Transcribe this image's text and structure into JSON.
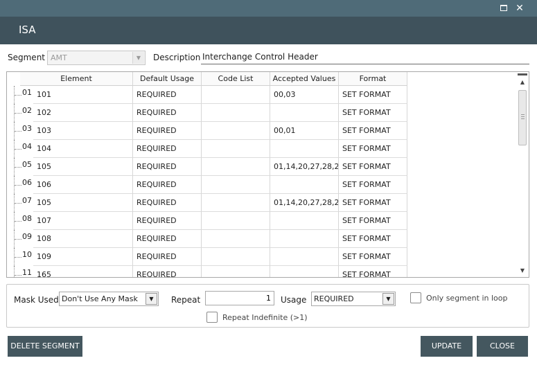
{
  "window": {
    "title": "ISA",
    "max_icon": "maximize-icon",
    "close_icon": "close-icon",
    "close_glyph": "✕"
  },
  "segment": {
    "label": "Segment",
    "value": "AMT"
  },
  "description": {
    "label": "Description",
    "value": "Interchange Control Header"
  },
  "grid": {
    "columns": [
      "Element",
      "Default Usage",
      "Code List",
      "Accepted Values",
      "Format"
    ],
    "rows": [
      {
        "num": "01",
        "element": "101",
        "usage": "REQUIRED",
        "code_list": "",
        "accepted": "00,03",
        "format": "SET FORMAT"
      },
      {
        "num": "02",
        "element": "102",
        "usage": "REQUIRED",
        "code_list": "",
        "accepted": "",
        "format": "SET FORMAT"
      },
      {
        "num": "03",
        "element": "103",
        "usage": "REQUIRED",
        "code_list": "",
        "accepted": "00,01",
        "format": "SET FORMAT"
      },
      {
        "num": "04",
        "element": "104",
        "usage": "REQUIRED",
        "code_list": "",
        "accepted": "",
        "format": "SET FORMAT"
      },
      {
        "num": "05",
        "element": "105",
        "usage": "REQUIRED",
        "code_list": "",
        "accepted": "01,14,20,27,28,2",
        "format": "SET FORMAT"
      },
      {
        "num": "06",
        "element": "106",
        "usage": "REQUIRED",
        "code_list": "",
        "accepted": "",
        "format": "SET FORMAT"
      },
      {
        "num": "07",
        "element": "105",
        "usage": "REQUIRED",
        "code_list": "",
        "accepted": "01,14,20,27,28,2",
        "format": "SET FORMAT"
      },
      {
        "num": "08",
        "element": "107",
        "usage": "REQUIRED",
        "code_list": "",
        "accepted": "",
        "format": "SET FORMAT"
      },
      {
        "num": "09",
        "element": "108",
        "usage": "REQUIRED",
        "code_list": "",
        "accepted": "",
        "format": "SET FORMAT"
      },
      {
        "num": "10",
        "element": "109",
        "usage": "REQUIRED",
        "code_list": "",
        "accepted": "",
        "format": "SET FORMAT"
      },
      {
        "num": "11",
        "element": "165",
        "usage": "REQUIRED",
        "code_list": "",
        "accepted": "",
        "format": "SET FORMAT"
      }
    ]
  },
  "options": {
    "mask_label": "Mask Used",
    "mask_value": "Don't Use Any Mask",
    "repeat_label": "Repeat",
    "repeat_value": "1",
    "usage_label": "Usage",
    "usage_value": "REQUIRED",
    "only_segment_label": "Only segment in loop",
    "repeat_indefinite_label": "Repeat Indefinite (>1)"
  },
  "buttons": {
    "delete": "DELETE SEGMENT",
    "update": "UPDATE",
    "close": "CLOSE"
  },
  "colors": {
    "titlebar": "#4f6b78",
    "header": "#3f525c",
    "button": "#44575f"
  }
}
